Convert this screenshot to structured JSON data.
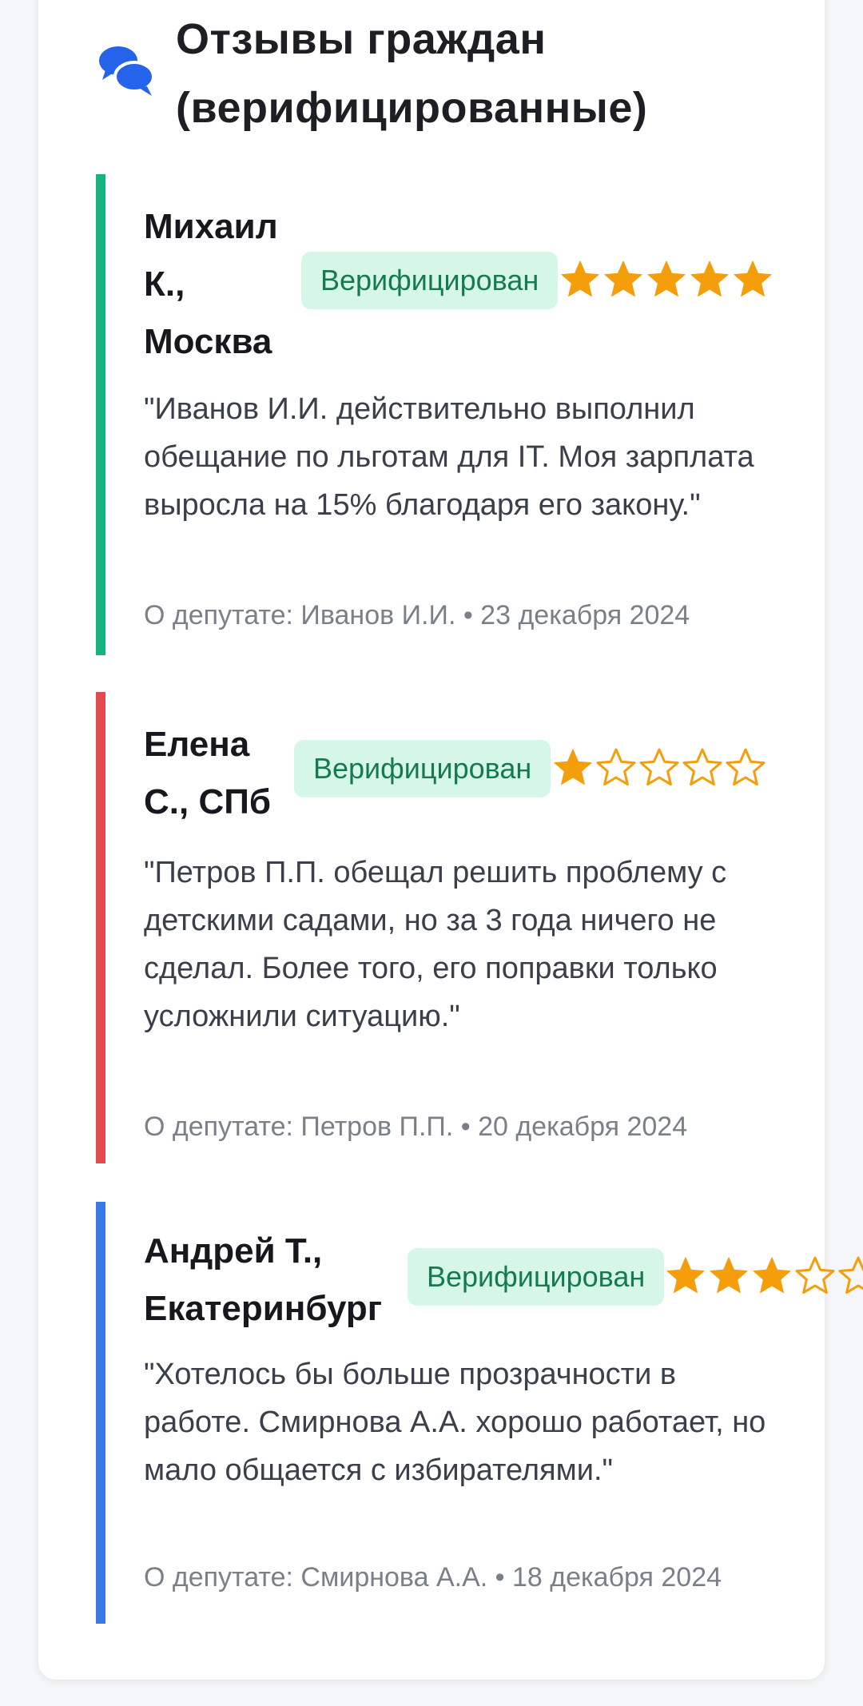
{
  "section": {
    "title": "Отзывы граждан (верифицированные)",
    "icon": "comments-icon",
    "accent_color": "#2563eb"
  },
  "reviews": [
    {
      "author": "Михаил К., Москва",
      "badge": "Верифицирован",
      "rating": 5,
      "max_rating": 5,
      "quote": "\"Иванов И.И. действительно выполнил обещание по льготам для IT. Моя зарплата выросла на 15% благодаря его закону.\"",
      "meta": "О депутате: Иванов И.И. • 23 декабря 2024",
      "border_color": "#16b381"
    },
    {
      "author": "Елена С., СПб",
      "badge": "Верифицирован",
      "rating": 1,
      "max_rating": 5,
      "quote": "\"Петров П.П. обещал решить проблему с детскими садами, но за 3 года ничего не сделал. Более того, его поправки только усложнили ситуацию.\"",
      "meta": "О депутате: Петров П.П. • 20 декабря 2024",
      "border_color": "#e34a4d"
    },
    {
      "author": "Андрей Т., Екатеринбург",
      "badge": "Верифицирован",
      "rating": 3,
      "max_rating": 5,
      "quote": "\"Хотелось бы больше прозрачности в работе. Смирнова А.А. хорошо работает, но мало общается с избирателями.\"",
      "meta": "О депутате: Смирнова А.А. • 18 декабря 2024",
      "border_color": "#3a79e6"
    }
  ],
  "colors": {
    "star_filled": "#f59e0b",
    "badge_bg": "#d6f7e7",
    "badge_text": "#157a50"
  }
}
